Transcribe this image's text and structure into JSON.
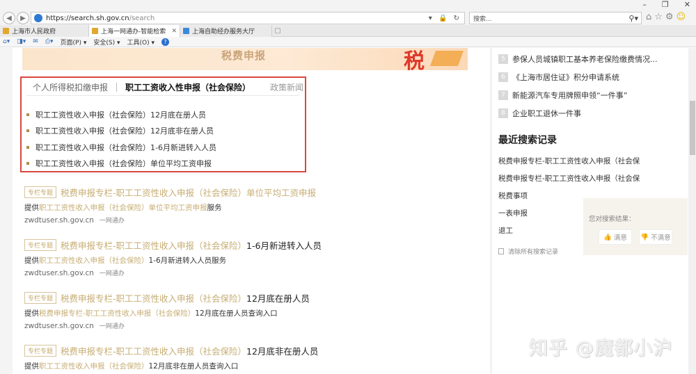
{
  "browser": {
    "window_controls": [
      "–",
      "❐",
      "✕"
    ],
    "url_host": "https://search.sh.gov.cn",
    "url_path": "/search",
    "addr_tools": "▾ 🔒 ↻",
    "search_placeholder": "搜索...",
    "tabs": [
      {
        "label": "上海市人民政府",
        "close": ""
      },
      {
        "label": "上海一网通办-智能检索",
        "close": "✕"
      },
      {
        "label": "上海自助经办服务大厅",
        "close": ""
      }
    ],
    "command_bar": {
      "page": "页面(P) ▾",
      "safety": "安全(S) ▾",
      "tools": "工具(O) ▾"
    }
  },
  "banner": {
    "title": "税费申报",
    "deco": "税"
  },
  "tabs": {
    "personal": "个人所得税扣缴申报",
    "social": "职工工资收入性申报（社会保险）",
    "news": "政策新闻"
  },
  "items": [
    "职工工资性收入申报（社会保险）12月底在册人员",
    "职工工资性收入申报（社会保险）12月底非在册人员",
    "职工工资性收入申报（社会保险）1-6月新进转入人员",
    "职工工资性收入申报（社会保险）单位平均工资申报"
  ],
  "results": [
    {
      "badge": "专栏专题",
      "prefix": "税费申报专栏-职工工资性收入申报（社会保险）",
      "suffix": "单位平均工资申报",
      "suffix_dark": false,
      "desc_pre": "提供",
      "desc_hl": "职工工资性收入申报（社会保险）单位平均工资申报",
      "desc_post": "服务",
      "domain": "zwdtuser.sh.gov.cn",
      "tag": "一网通办"
    },
    {
      "badge": "专栏专题",
      "prefix": "税费申报专栏-职工工资性收入申报（社会保险）",
      "suffix": "1-6月新进转入人员",
      "suffix_dark": true,
      "desc_pre": "提供",
      "desc_hl": "职工工资性收入申报（社会保险）",
      "desc_post": "1-6月新进转入人员服务",
      "domain": "zwdtuser.sh.gov.cn",
      "tag": "一网通办"
    },
    {
      "badge": "专栏专题",
      "prefix": "税费申报专栏-职工工资性收入申报（社会保险）",
      "suffix": "12月底在册人员",
      "suffix_dark": true,
      "desc_pre": "提供",
      "desc_hl": "税费申报专栏-职工工资性收入申报（社会保险）",
      "desc_post": "12月底在册人员查询入口",
      "domain": "zwdtuser.sh.gov.cn",
      "tag": "一网通办"
    },
    {
      "badge": "专栏专题",
      "prefix": "税费申报专栏-职工工资性收入申报（社会保险）",
      "suffix": "12月底非在册人员",
      "suffix_dark": true,
      "desc_pre": "提供",
      "desc_hl": "职工工资性收入申报（社会保险）",
      "desc_post": "12月底非在册人员查询入口",
      "domain": "",
      "tag": ""
    }
  ],
  "right": {
    "hot_items": [
      {
        "n": "5",
        "label": "参保人员城镇职工基本养老保险缴费情况..."
      },
      {
        "n": "6",
        "label": "《上海市居住证》积分申请系统"
      },
      {
        "n": "7",
        "label": "新能源汽车专用牌照申领“一件事”"
      },
      {
        "n": "8",
        "label": "企业职工退休一件事"
      }
    ],
    "recent_title": "最近搜索记录",
    "recent": [
      "税费申报专栏-职工工资性收入申报（社会保",
      "税费申报专栏-职工工资性收入申报（社会保",
      "税费事项",
      "一表申报",
      "退工"
    ],
    "clear_label": "清除所有搜索记录"
  },
  "feedback": {
    "question": "您对搜索结果：",
    "like": "满意",
    "dislike": "不满意"
  },
  "watermark": "知乎 @魔都小沪"
}
